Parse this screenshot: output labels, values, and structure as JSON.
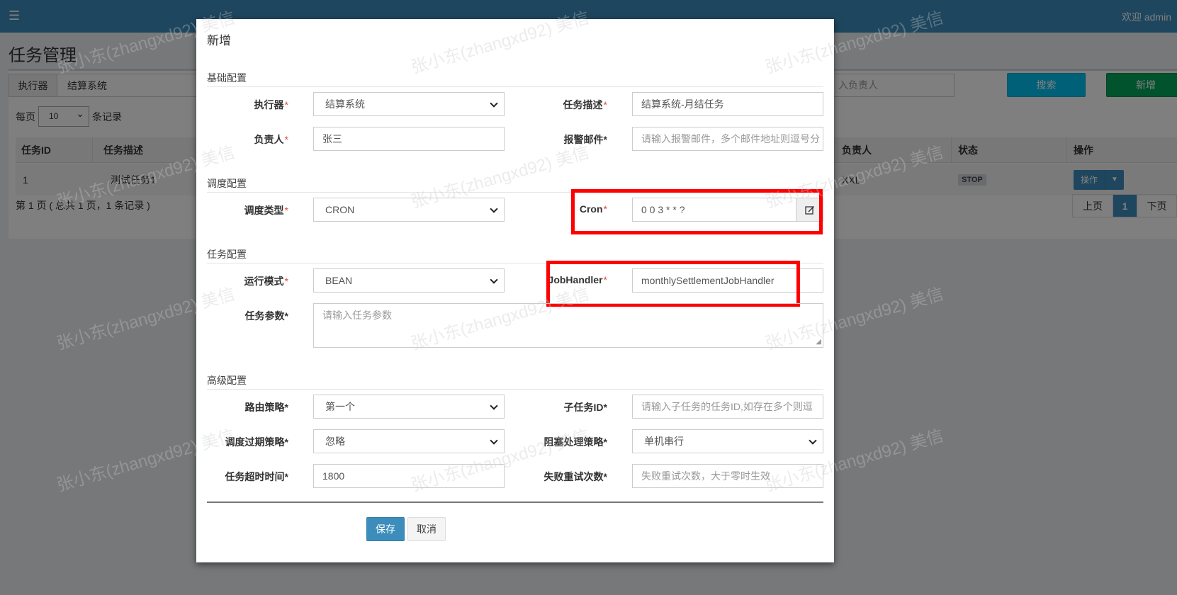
{
  "topbar": {
    "menu_icon": "☰",
    "welcome": "欢迎 admin"
  },
  "page": {
    "title": "任务管理"
  },
  "filter": {
    "executor_label": "执行器",
    "executor_value": "结算系统",
    "owner_placeholder": "入负责人",
    "search_label": "搜索",
    "add_label": "新增"
  },
  "perpage": {
    "prefix": "每页",
    "value": "10",
    "suffix": "条记录"
  },
  "table": {
    "headers": [
      "任务ID",
      "任务描述",
      "负责人",
      "状态",
      "操作"
    ],
    "rows": [
      {
        "id": "1",
        "desc": "测试任务1",
        "owner": "XXL",
        "status": "STOP",
        "op": "操作"
      }
    ]
  },
  "pagination": {
    "info": "第 1 页 ( 总共 1 页，1 条记录 )",
    "prev": "上页",
    "current": "1",
    "next": "下页"
  },
  "modal": {
    "title": "新增",
    "sections": {
      "basic": "基础配置",
      "schedule": "调度配置",
      "task": "任务配置",
      "advanced": "高级配置"
    },
    "fields": {
      "executor": {
        "label": "执行器",
        "value": "结算系统"
      },
      "desc": {
        "label": "任务描述",
        "value": "结算系统-月结任务"
      },
      "owner": {
        "label": "负责人",
        "value": "张三"
      },
      "alarm_email": {
        "label": "报警邮件",
        "placeholder": "请输入报警邮件，多个邮件地址则逗号分"
      },
      "schedule_type": {
        "label": "调度类型",
        "value": "CRON"
      },
      "cron": {
        "label": "Cron",
        "value": "0 0 3 * * ?"
      },
      "run_mode": {
        "label": "运行模式",
        "value": "BEAN"
      },
      "job_handler": {
        "label": "JobHandler",
        "value": "monthlySettlementJobHandler"
      },
      "params": {
        "label": "任务参数",
        "placeholder": "请输入任务参数"
      },
      "route": {
        "label": "路由策略",
        "value": "第一个"
      },
      "child_id": {
        "label": "子任务ID",
        "placeholder": "请输入子任务的任务ID,如存在多个则逗"
      },
      "misfire": {
        "label": "调度过期策略",
        "value": "忽略"
      },
      "block": {
        "label": "阻塞处理策略",
        "value": "单机串行"
      },
      "timeout": {
        "label": "任务超时时间",
        "value": "1800"
      },
      "retry": {
        "label": "失败重试次数",
        "placeholder": "失败重试次数，大于零时生效"
      }
    },
    "save_label": "保存",
    "cancel_label": "取消"
  },
  "watermark": "张小东(zhangxd92) 美信",
  "colors": {
    "primary": "#3c8dbc",
    "info": "#00c0ef",
    "success": "#00a65a",
    "highlight": "#ff0000"
  }
}
